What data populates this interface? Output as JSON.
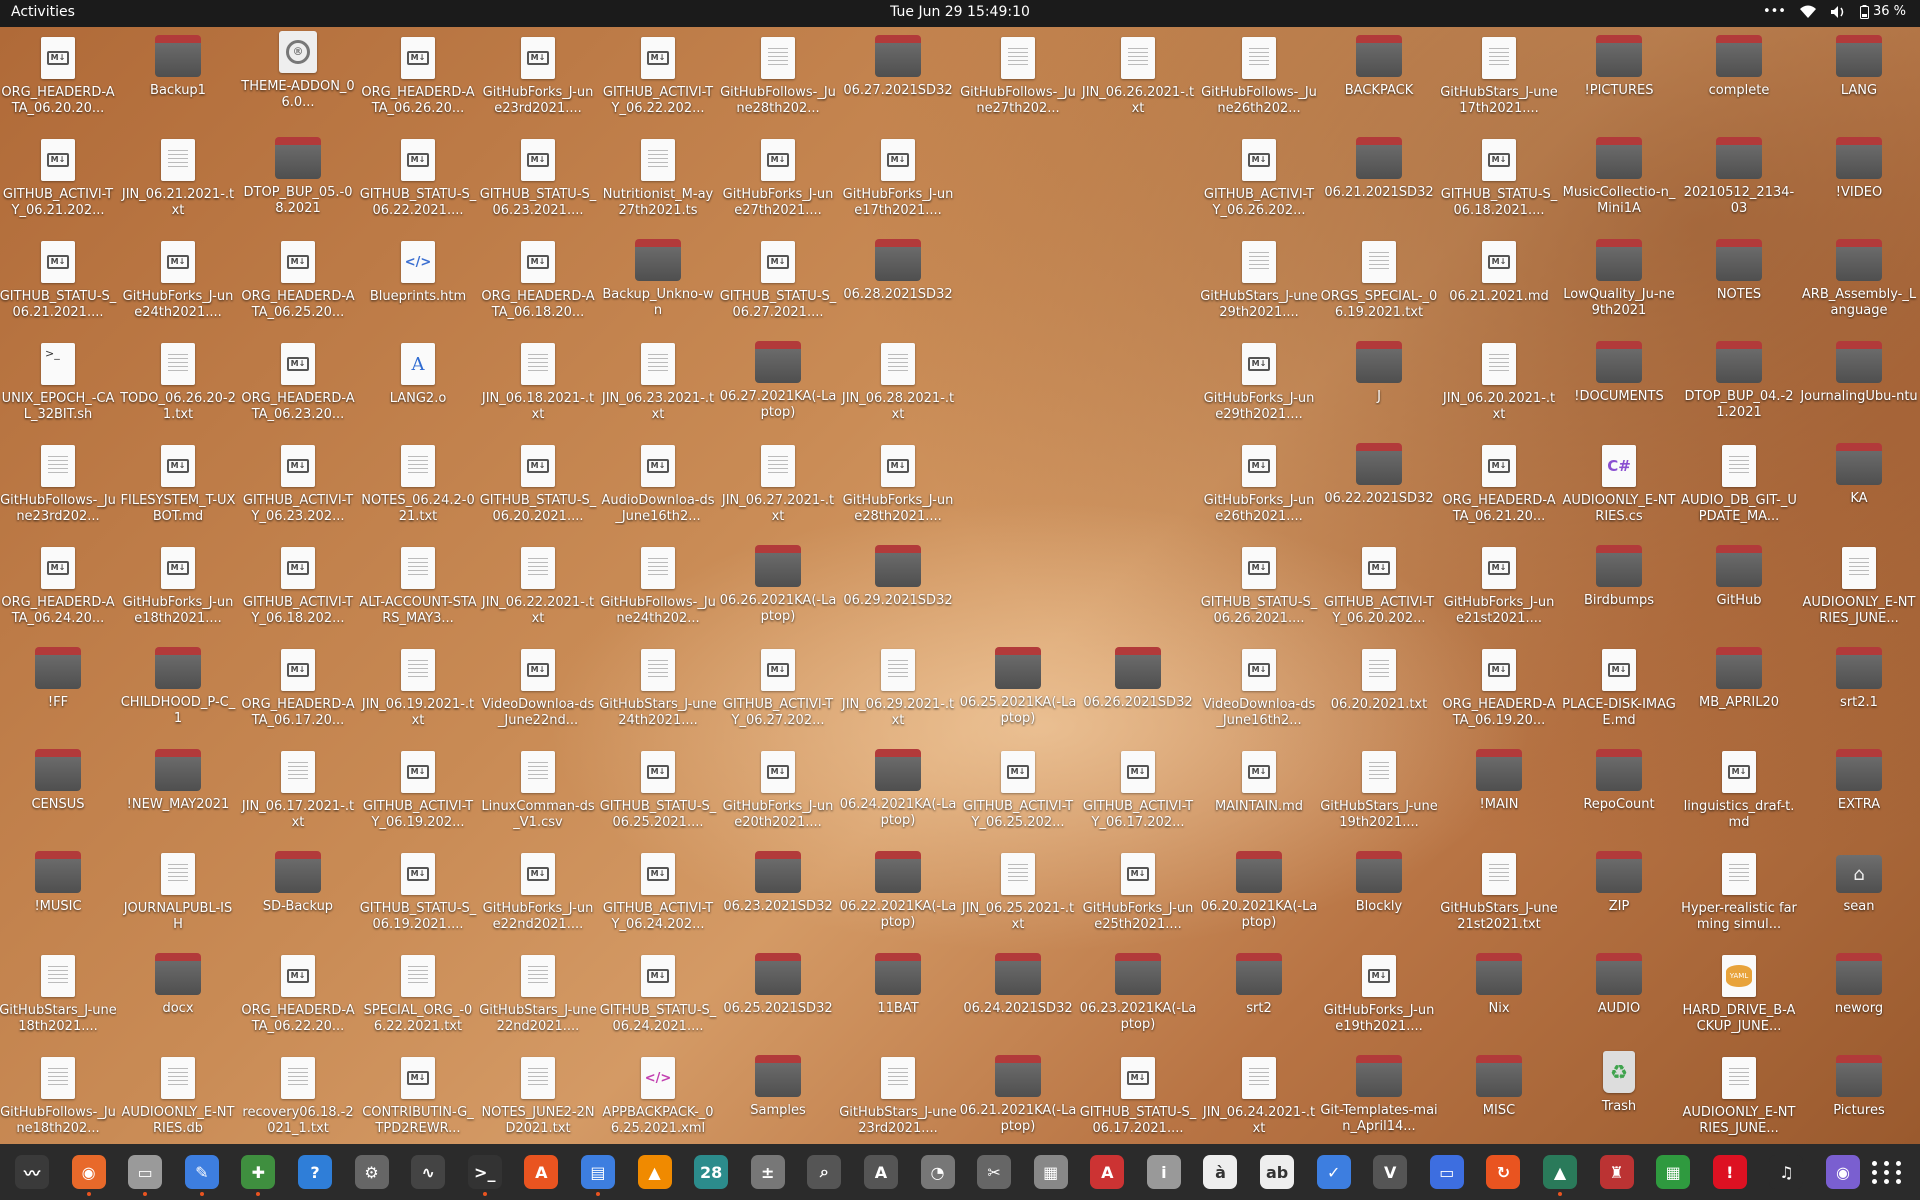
{
  "topbar": {
    "activities": "Activities",
    "clock": "Tue Jun 29  15:49:10",
    "menu_dots": "•••",
    "battery": "36 %"
  },
  "desktop_icons": [
    [
      [
        "md",
        "ORG_HEADERD-ATA_06.20.20..."
      ],
      [
        "folder",
        "Backup1"
      ],
      [
        "theme",
        "THEME-ADDON_06.0..."
      ],
      [
        "md",
        "ORG_HEADERD-ATA_06.26.20..."
      ],
      [
        "md",
        "GitHubForks_J-une23rd2021...."
      ],
      [
        "md",
        "GITHUB_ACTIVI-TY_06.22.202..."
      ],
      [
        "doc",
        "GitHubFollows-_June28th202..."
      ],
      [
        "folder",
        "06.27.2021SD32"
      ],
      [
        "doc",
        "GitHubFollows-_June27th202..."
      ],
      [
        "doc",
        "JIN_06.26.2021-.txt"
      ],
      [
        "doc",
        "GitHubFollows-_June26th202..."
      ],
      [
        "folder",
        "BACKPACK"
      ],
      [
        "doc",
        "GitHubStars_J-une17th2021...."
      ],
      [
        "folder",
        "!PICTURES"
      ],
      [
        "folder",
        "complete"
      ],
      [
        "folder",
        "LANG"
      ]
    ],
    [
      [
        "md",
        "GITHUB_ACTIVI-TY_06.21.202..."
      ],
      [
        "doc",
        "JIN_06.21.2021-.txt"
      ],
      [
        "folder",
        "DTOP_BUP_05.-08.2021"
      ],
      [
        "md",
        "GITHUB_STATU-S_06.22.2021...."
      ],
      [
        "md",
        "GITHUB_STATU-S_06.23.2021...."
      ],
      [
        "doc",
        "Nutritionist_M-ay27th2021.ts"
      ],
      [
        "md",
        "GitHubForks_J-une27th2021...."
      ],
      [
        "md",
        "GitHubForks_J-une17th2021...."
      ],
      null,
      null,
      [
        "md",
        "GITHUB_ACTIVI-TY_06.26.202..."
      ],
      [
        "folder",
        "06.21.2021SD32"
      ],
      [
        "md",
        "GITHUB_STATU-S_06.18.2021...."
      ],
      [
        "folder",
        "MusicCollectio-n_Mini1A"
      ],
      [
        "folder",
        "20210512_2134-03"
      ],
      [
        "folder",
        "!VIDEO"
      ]
    ],
    [
      [
        "md",
        "GITHUB_STATU-S_06.21.2021...."
      ],
      [
        "md",
        "GitHubForks_J-une24th2021...."
      ],
      [
        "md",
        "ORG_HEADERD-ATA_06.25.20..."
      ],
      [
        "code",
        "Blueprints.htm"
      ],
      [
        "md",
        "ORG_HEADERD-ATA_06.18.20..."
      ],
      [
        "folder",
        "Backup_Unkno-wn"
      ],
      [
        "md",
        "GITHUB_STATU-S_06.27.2021...."
      ],
      [
        "folder",
        "06.28.2021SD32"
      ],
      null,
      null,
      [
        "doc",
        "GitHubStars_J-une29th2021...."
      ],
      [
        "doc",
        "ORGS_SPECIAL-_06.19.2021.txt"
      ],
      [
        "md",
        "06.21.2021.md"
      ],
      [
        "folder",
        "LowQuality_Ju-ne9th2021"
      ],
      [
        "folder",
        "NOTES"
      ],
      [
        "folder",
        "ARB_Assembly-_Language"
      ]
    ],
    [
      [
        "sh",
        "UNIX_EPOCH_-CAL_32BIT.sh"
      ],
      [
        "doc",
        "TODO_06.26.20-21.txt"
      ],
      [
        "md",
        "ORG_HEADERD-ATA_06.23.20..."
      ],
      [
        "font",
        "LANG2.o"
      ],
      [
        "doc",
        "JIN_06.18.2021-.txt"
      ],
      [
        "doc",
        "JIN_06.23.2021-.txt"
      ],
      [
        "folder",
        "06.27.2021KA(-Laptop)"
      ],
      [
        "doc",
        "JIN_06.28.2021-.txt"
      ],
      null,
      null,
      [
        "md",
        "GitHubForks_J-une29th2021...."
      ],
      [
        "folder",
        "J"
      ],
      [
        "doc",
        "JIN_06.20.2021-.txt"
      ],
      [
        "folder",
        "!DOCUMENTS"
      ],
      [
        "folder",
        "DTOP_BUP_04.-21.2021"
      ],
      [
        "folder",
        "JournalingUbu-ntu"
      ]
    ],
    [
      [
        "doc",
        "GitHubFollows-_June23rd202..."
      ],
      [
        "md",
        "FILESYSTEM_T-UXBOT.md"
      ],
      [
        "md",
        "GITHUB_ACTIVI-TY_06.23.202..."
      ],
      [
        "doc",
        "NOTES_06.24.2-021.txt"
      ],
      [
        "md",
        "GITHUB_STATU-S_06.20.2021...."
      ],
      [
        "md",
        "AudioDownloa-ds_June16th2..."
      ],
      [
        "doc",
        "JIN_06.27.2021-.txt"
      ],
      [
        "md",
        "GitHubForks_J-une28th2021...."
      ],
      null,
      null,
      [
        "md",
        "GitHubForks_J-une26th2021...."
      ],
      [
        "folder",
        "06.22.2021SD32"
      ],
      [
        "md",
        "ORG_HEADERD-ATA_06.21.20..."
      ],
      [
        "cs",
        "AUDIOONLY_E-NTRIES.cs"
      ],
      [
        "doc",
        "AUDIO_DB_GIT-_UPDATE_MA..."
      ],
      [
        "folder",
        "KA"
      ]
    ],
    [
      [
        "md",
        "ORG_HEADERD-ATA_06.24.20..."
      ],
      [
        "md",
        "GitHubForks_J-une18th2021...."
      ],
      [
        "md",
        "GITHUB_ACTIVI-TY_06.18.202..."
      ],
      [
        "doc",
        "ALT-ACCOUNT-STARS_MAY3..."
      ],
      [
        "doc",
        "JIN_06.22.2021-.txt"
      ],
      [
        "doc",
        "GitHubFollows-_June24th202..."
      ],
      [
        "folder",
        "06.26.2021KA(-Laptop)"
      ],
      [
        "folder",
        "06.29.2021SD32"
      ],
      null,
      null,
      [
        "md",
        "GITHUB_STATU-S_06.26.2021...."
      ],
      [
        "md",
        "GITHUB_ACTIVI-TY_06.20.202..."
      ],
      [
        "md",
        "GitHubForks_J-une21st2021...."
      ],
      [
        "folder",
        "Birdbumps"
      ],
      [
        "folder",
        "GitHub"
      ],
      [
        "doc",
        "AUDIOONLY_E-NTRIES_JUNE..."
      ]
    ],
    [
      [
        "folder",
        "!FF"
      ],
      [
        "folder",
        "CHILDHOOD_P-C_1"
      ],
      [
        "md",
        "ORG_HEADERD-ATA_06.17.20..."
      ],
      [
        "doc",
        "JIN_06.19.2021-.txt"
      ],
      [
        "md",
        "VideoDownloa-ds_June22nd..."
      ],
      [
        "doc",
        "GitHubStars_J-une24th2021...."
      ],
      [
        "md",
        "GITHUB_ACTIVI-TY_06.27.202..."
      ],
      [
        "doc",
        "JIN_06.29.2021-.txt"
      ],
      [
        "folder",
        "06.25.2021KA(-Laptop)"
      ],
      [
        "folder",
        "06.26.2021SD32"
      ],
      [
        "md",
        "VideoDownloa-ds_June16th2..."
      ],
      [
        "doc",
        "06.20.2021.txt"
      ],
      [
        "md",
        "ORG_HEADERD-ATA_06.19.20..."
      ],
      [
        "md",
        "PLACE-DISK-IMAGE.md"
      ],
      [
        "folder",
        "MB_APRIL20"
      ],
      [
        "folder",
        "srt2.1"
      ]
    ],
    [
      [
        "folder",
        "CENSUS"
      ],
      [
        "folder",
        "!NEW_MAY2021"
      ],
      [
        "doc",
        "JIN_06.17.2021-.txt"
      ],
      [
        "md",
        "GITHUB_ACTIVI-TY_06.19.202..."
      ],
      [
        "doc",
        "LinuxComman-ds_V1.csv"
      ],
      [
        "md",
        "GITHUB_STATU-S_06.25.2021...."
      ],
      [
        "md",
        "GitHubForks_J-une20th2021...."
      ],
      [
        "folder",
        "06.24.2021KA(-Laptop)"
      ],
      [
        "md",
        "GITHUB_ACTIVI-TY_06.25.202..."
      ],
      [
        "md",
        "GITHUB_ACTIVI-TY_06.17.202..."
      ],
      [
        "md",
        "MAINTAIN.md"
      ],
      [
        "doc",
        "GitHubStars_J-une19th2021...."
      ],
      [
        "folder",
        "!MAIN"
      ],
      [
        "folder",
        "RepoCount"
      ],
      [
        "md",
        "linguistics_draf-t.md"
      ],
      [
        "folder",
        "EXTRA"
      ]
    ],
    [
      [
        "folder",
        "!MUSIC"
      ],
      [
        "doc",
        "JOURNALPUBL-ISH"
      ],
      [
        "folder",
        "SD-Backup"
      ],
      [
        "md",
        "GITHUB_STATU-S_06.19.2021...."
      ],
      [
        "md",
        "GitHubForks_J-une22nd2021...."
      ],
      [
        "md",
        "GITHUB_ACTIVI-TY_06.24.202..."
      ],
      [
        "folder",
        "06.23.2021SD32"
      ],
      [
        "folder",
        "06.22.2021KA(-Laptop)"
      ],
      [
        "doc",
        "JIN_06.25.2021-.txt"
      ],
      [
        "md",
        "GitHubForks_J-une25th2021...."
      ],
      [
        "folder",
        "06.20.2021KA(-Laptop)"
      ],
      [
        "folder",
        "Blockly"
      ],
      [
        "doc",
        "GitHubStars_J-une21st2021.txt"
      ],
      [
        "folder",
        "ZIP"
      ],
      [
        "doc",
        "Hyper-realistic farming simul..."
      ],
      [
        "home",
        "sean"
      ]
    ],
    [
      [
        "doc",
        "GitHubStars_J-une18th2021...."
      ],
      [
        "folder",
        "docx"
      ],
      [
        "md",
        "ORG_HEADERD-ATA_06.22.20..."
      ],
      [
        "doc",
        "SPECIAL_ORG_-06.22.2021.txt"
      ],
      [
        "doc",
        "GitHubStars_J-une22nd2021...."
      ],
      [
        "md",
        "GITHUB_STATU-S_06.24.2021...."
      ],
      [
        "folder",
        "06.25.2021SD32"
      ],
      [
        "folder",
        "11BAT"
      ],
      [
        "folder",
        "06.24.2021SD32"
      ],
      [
        "folder",
        "06.23.2021KA(-Laptop)"
      ],
      [
        "folder",
        "srt2"
      ],
      [
        "md",
        "GitHubForks_J-une19th2021...."
      ],
      [
        "folder",
        "Nix"
      ],
      [
        "folder",
        "AUDIO"
      ],
      [
        "yaml",
        "HARD_DRIVE_B-ACKUP_JUNE..."
      ],
      [
        "folder",
        "neworg"
      ]
    ],
    [
      [
        "doc",
        "GitHubFollows-_June18th202..."
      ],
      [
        "doc",
        "AUDIOONLY_E-NTRIES.db"
      ],
      [
        "doc",
        "recovery06.18.-2021_1.txt"
      ],
      [
        "md",
        "CONTRIBUTIN-G_TPD2REWR..."
      ],
      [
        "doc",
        "NOTES_JUNE2-2ND2021.txt"
      ],
      [
        "xml",
        "APPBACKPACK-_06.25.2021.xml"
      ],
      [
        "folder",
        "Samples"
      ],
      [
        "doc",
        "GitHubStars_J-une23rd2021...."
      ],
      [
        "folder",
        "06.21.2021KA(-Laptop)"
      ],
      [
        "md",
        "GITHUB_STATU-S_06.17.2021...."
      ],
      [
        "doc",
        "JIN_06.24.2021-.txt"
      ],
      [
        "folder",
        "Git-Templates-main_April14..."
      ],
      [
        "folder",
        "MISC"
      ],
      [
        "trash",
        "Trash"
      ],
      [
        "doc",
        "AUDIOONLY_E-NTRIES_JUNE..."
      ],
      [
        "folder",
        "Pictures"
      ]
    ]
  ],
  "dock": [
    {
      "name": "system-monitor",
      "color": "#3a3a3a",
      "glyph": "〰"
    },
    {
      "name": "firefox",
      "color": "#e8692a",
      "glyph": "◉"
    },
    {
      "name": "files",
      "color": "#9a9a9a",
      "glyph": "▭"
    },
    {
      "name": "text-editor",
      "color": "#3d7ee0",
      "glyph": "✎"
    },
    {
      "name": "extensions",
      "color": "#3f8f3f",
      "glyph": "✚"
    },
    {
      "name": "help",
      "color": "#2f7ed8",
      "glyph": "?"
    },
    {
      "name": "settings",
      "color": "#666",
      "glyph": "⚙"
    },
    {
      "name": "sound-recorder",
      "color": "#444",
      "glyph": "∿"
    },
    {
      "name": "terminal",
      "color": "#333",
      "glyph": ">_"
    },
    {
      "name": "software",
      "color": "#e95420",
      "glyph": "A"
    },
    {
      "name": "document-viewer",
      "color": "#3d7ee0",
      "glyph": "▤"
    },
    {
      "name": "vlc",
      "color": "#f08a00",
      "glyph": "▲"
    },
    {
      "name": "calendar",
      "color": "#2c8c8c",
      "glyph": "28"
    },
    {
      "name": "calculator",
      "color": "#777",
      "glyph": "±"
    },
    {
      "name": "search",
      "color": "#555",
      "glyph": "⌕"
    },
    {
      "name": "software-updater",
      "color": "#555",
      "glyph": "A"
    },
    {
      "name": "disk-usage",
      "color": "#777",
      "glyph": "◔"
    },
    {
      "name": "screenshot",
      "color": "#666",
      "glyph": "✂"
    },
    {
      "name": "drawing",
      "color": "#888",
      "glyph": "▦"
    },
    {
      "name": "font-viewer",
      "color": "#c33",
      "glyph": "A"
    },
    {
      "name": "archive-manager",
      "color": "#999",
      "glyph": "i"
    },
    {
      "name": "character-map",
      "color": "#eee",
      "glyph": "à"
    },
    {
      "name": "spell-checker",
      "color": "#eee",
      "glyph": "ab"
    },
    {
      "name": "todo",
      "color": "#3d7ee0",
      "glyph": "✓"
    },
    {
      "name": "vim",
      "color": "#555",
      "glyph": "V"
    },
    {
      "name": "screen-share",
      "color": "#3d6ee0",
      "glyph": "▭"
    },
    {
      "name": "update",
      "color": "#e95420",
      "glyph": "↻"
    },
    {
      "name": "education",
      "color": "#2a7a5a",
      "glyph": "▲"
    },
    {
      "name": "game",
      "color": "#b33",
      "glyph": "♜"
    },
    {
      "name": "spreadsheet",
      "color": "#2f9a3f",
      "glyph": "▦"
    },
    {
      "name": "alert",
      "color": "#d12",
      "glyph": "!"
    },
    {
      "name": "music",
      "color": "#2b2b2b",
      "glyph": "♫"
    },
    {
      "name": "camera",
      "color": "#7a5fd0",
      "glyph": "◉"
    }
  ],
  "dock_running": [
    "firefox",
    "files",
    "text-editor",
    "extensions",
    "terminal",
    "document-viewer",
    "education"
  ]
}
